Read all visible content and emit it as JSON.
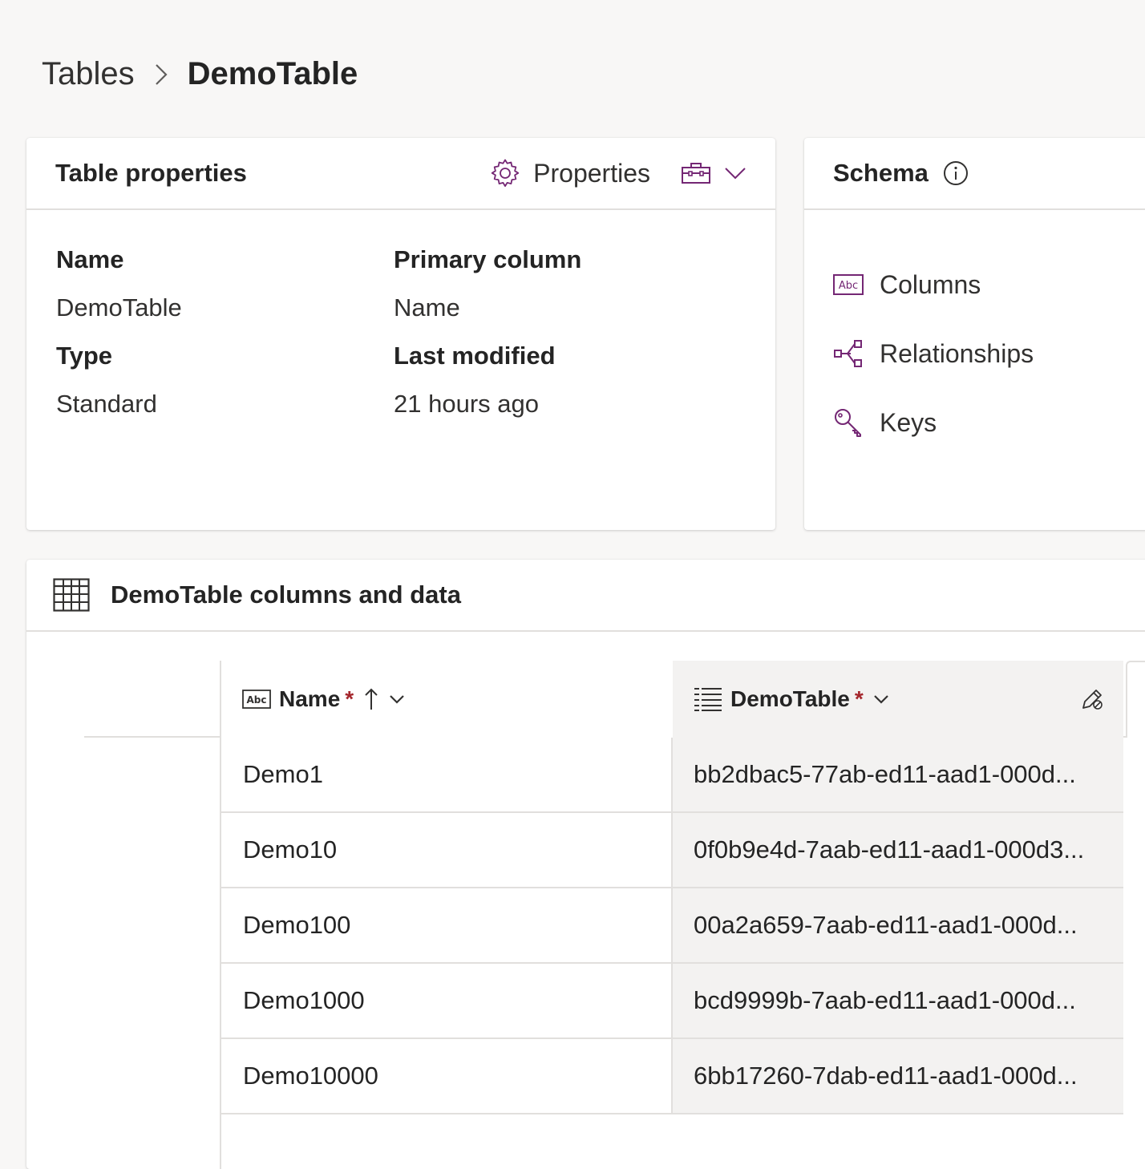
{
  "breadcrumb": {
    "root": "Tables",
    "current": "DemoTable"
  },
  "properties_card": {
    "title": "Table properties",
    "properties_button": "Properties",
    "fields": {
      "name_label": "Name",
      "name_value": "DemoTable",
      "type_label": "Type",
      "type_value": "Standard",
      "primary_label": "Primary column",
      "primary_value": "Name",
      "modified_label": "Last modified",
      "modified_value": "21 hours ago"
    }
  },
  "schema_card": {
    "title": "Schema",
    "items": [
      {
        "label": "Columns",
        "icon": "abc-icon"
      },
      {
        "label": "Relationships",
        "icon": "relationships-icon"
      },
      {
        "label": "Keys",
        "icon": "key-icon"
      }
    ]
  },
  "data_card": {
    "title": "DemoTable columns and data",
    "columns": [
      {
        "label": "Name",
        "required_mark": "*"
      },
      {
        "label": "DemoTable",
        "required_mark": "*"
      }
    ],
    "rows": [
      {
        "name": "Demo1",
        "id": "bb2dbac5-77ab-ed11-aad1-000d..."
      },
      {
        "name": "Demo10",
        "id": "0f0b9e4d-7aab-ed11-aad1-000d3..."
      },
      {
        "name": "Demo100",
        "id": "00a2a659-7aab-ed11-aad1-000d..."
      },
      {
        "name": "Demo1000",
        "id": "bcd9999b-7aab-ed11-aad1-000d..."
      },
      {
        "name": "Demo10000",
        "id": "6bb17260-7dab-ed11-aad1-000d..."
      }
    ]
  },
  "colors": {
    "accent": "#742774",
    "required": "#a4262c",
    "background": "#f8f7f6"
  }
}
